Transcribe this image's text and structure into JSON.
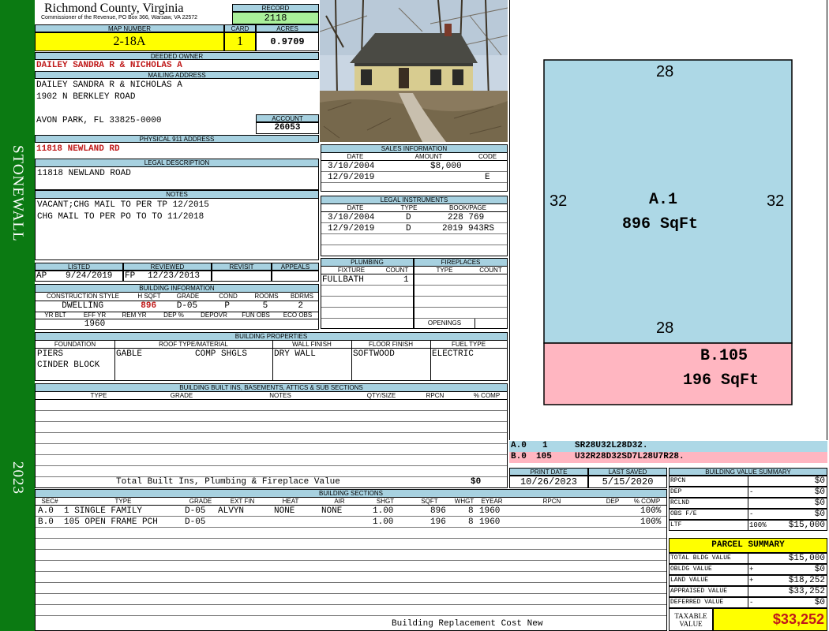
{
  "side": {
    "left_text": "STONEWALL",
    "year": "2023"
  },
  "header": {
    "county": "Richmond County, Virginia",
    "address_line": "Commissioner of the Revenue, PO Box 366, Warsaw, VA 22572",
    "record_label": "RECORD",
    "record": "2118",
    "map_number_label": "MAP NUMBER",
    "map_number": "2-18A",
    "card_label": "CARD",
    "card": "1",
    "acres_label": "ACRES",
    "acres": "0.9709"
  },
  "owner": {
    "label": "DEEDED OWNER",
    "value": "DAILEY SANDRA R & NICHOLAS A"
  },
  "mailing": {
    "label": "MAILING ADDRESS",
    "line1": "DAILEY SANDRA R & NICHOLAS A",
    "line2": "1902 N BERKLEY ROAD",
    "line3": "AVON PARK, FL 33825-0000",
    "account_label": "ACCOUNT",
    "account": "26053"
  },
  "physical": {
    "label": "PHYSICAL 911 ADDRESS",
    "value": "11818 NEWLAND RD"
  },
  "legal": {
    "label": "LEGAL DESCRIPTION",
    "value": "11818 NEWLAND ROAD"
  },
  "notes": {
    "label": "NOTES",
    "line1": "VACANT;CHG MAIL TO PER TP 12/2015",
    "line2": "CHG MAIL TO PER PO TO TO 11/2018"
  },
  "sales": {
    "label": "SALES INFORMATION",
    "cols": [
      "DATE",
      "AMOUNT",
      "CODE"
    ],
    "rows": [
      {
        "date": "3/10/2004",
        "amount": "$8,000",
        "code": ""
      },
      {
        "date": "12/9/2019",
        "amount": "",
        "code": "E"
      }
    ]
  },
  "instruments": {
    "label": "LEGAL INSTRUMENTS",
    "cols": [
      "DATE",
      "TYPE",
      "BOOK/PAGE"
    ],
    "rows": [
      {
        "date": "3/10/2004",
        "type": "D",
        "book": "228 769"
      },
      {
        "date": "12/9/2019",
        "type": "D",
        "book": "2019 943RS"
      }
    ]
  },
  "listed": {
    "labels": [
      "LISTED",
      "REVIEWED",
      "REVISIT",
      "APPEALS"
    ],
    "listed_by": "AP",
    "listed_date": "9/24/2019",
    "reviewed_by": "FP",
    "reviewed_date": "12/23/2013"
  },
  "building_info": {
    "label": "BUILDING INFORMATION",
    "cols1": [
      "CONSTRUCTION STYLE",
      "H SQFT",
      "GRADE",
      "COND",
      "ROOMS",
      "BDRMS"
    ],
    "vals1": [
      "DWELLING",
      "896",
      "D-05",
      "P",
      "5",
      "2"
    ],
    "cols2": [
      "YR BLT",
      "EFF YR",
      "REM YR",
      "DEP %",
      "DEPOVR",
      "FUN OBS",
      "ECO OBS"
    ],
    "vals2": [
      "",
      "1960",
      "",
      "",
      "",
      "",
      ""
    ]
  },
  "plumbing": {
    "label": "PLUMBING",
    "cols": [
      "FIXTURE",
      "COUNT"
    ],
    "fixture": "FULLBATH",
    "count": "1"
  },
  "fireplaces": {
    "label": "FIREPLACES",
    "cols": [
      "TYPE",
      "COUNT"
    ],
    "openings_label": "OPENINGS"
  },
  "properties": {
    "label": "BUILDING PROPERTIES",
    "cols": [
      "FOUNDATION",
      "ROOF TYPE/MATERIAL",
      "WALL FINISH",
      "FLOOR FINISH",
      "FUEL TYPE"
    ],
    "foundation1": "PIERS",
    "foundation2": "CINDER BLOCK",
    "roof_type": "GABLE",
    "roof_material": "COMP SHGLS",
    "wall": "DRY WALL",
    "floor": "SOFTWOOD",
    "fuel": "ELECTRIC"
  },
  "builtins": {
    "label": "BUILDING BUILT INS, BASEMENTS, ATTICS & SUB SECTIONS",
    "cols": [
      "TYPE",
      "GRADE",
      "NOTES",
      "QTY/SIZE",
      "RPCN",
      "% COMP"
    ],
    "total_label": "Total Built Ins, Plumbing & Fireplace Value",
    "total": "$0"
  },
  "sketch": {
    "a_top": "28",
    "a_left": "32",
    "a_right": "32",
    "a_bottom": "28",
    "a_label": "A.1",
    "a_area": "896 SqFt",
    "b_label": "B.105",
    "b_area": "196 SqFt",
    "colors": {
      "a": "#add8e6",
      "b": "#ffb6c1"
    }
  },
  "vectors": [
    {
      "sec": "A.0",
      "code": "1",
      "path": "SR28U32L28D32."
    },
    {
      "sec": "B.0",
      "code": "105",
      "path": "U32R28D32SD7L28U7R28."
    }
  ],
  "print": {
    "print_label": "PRINT DATE",
    "print_date": "10/26/2023",
    "saved_label": "LAST SAVED",
    "saved_date": "5/15/2020"
  },
  "sections": {
    "label": "BUILDING SECTIONS",
    "cols": [
      "SEC#",
      "TYPE",
      "GRADE",
      "EXT FIN",
      "HEAT",
      "AIR",
      "SHGT",
      "SQFT",
      "WHGT",
      "EYEAR",
      "RPCN",
      "DEP",
      "% COMP"
    ],
    "rows": [
      {
        "sec": "A.0",
        "type": "1 SINGLE FAMILY",
        "grade": "D-05",
        "ext": "ALVYN",
        "heat": "NONE",
        "air": "NONE",
        "shgt": "1.00",
        "sqft": "896",
        "whgt": "8",
        "eyear": "1960",
        "rpcn": "",
        "dep": "",
        "comp": "100%"
      },
      {
        "sec": "B.0",
        "type": "105 OPEN FRAME PCH",
        "grade": "D-05",
        "ext": "",
        "heat": "",
        "air": "",
        "shgt": "1.00",
        "sqft": "196",
        "whgt": "8",
        "eyear": "1960",
        "rpcn": "",
        "dep": "",
        "comp": "100%"
      }
    ],
    "footer": "Building Replacement Cost New"
  },
  "value_summary": {
    "label": "BUILDING VALUE SUMMARY",
    "rows": [
      {
        "label": "RPCN",
        "op": "",
        "value": "$0"
      },
      {
        "label": "DEP",
        "op": "-",
        "value": "$0"
      },
      {
        "label": "RCLND",
        "op": "",
        "value": "$0"
      },
      {
        "label": "OBS F/E",
        "op": "-",
        "value": "$0"
      },
      {
        "label": "LTF",
        "op": "100%",
        "value": "$15,000"
      }
    ]
  },
  "parcel": {
    "label": "PARCEL SUMMARY",
    "rows": [
      {
        "label": "TOTAL BLDG VALUE",
        "op": "",
        "value": "$15,000"
      },
      {
        "label": "OBLDG VALUE",
        "op": "+",
        "value": "$0"
      },
      {
        "label": "LAND VALUE",
        "op": "+",
        "value": "$18,252"
      },
      {
        "label": "APPRAISED VALUE",
        "op": "",
        "value": "$33,252"
      },
      {
        "label": "DEFERRED VALUE",
        "op": "-",
        "value": "$0"
      }
    ],
    "taxable_label1": "TAXABLE",
    "taxable_label2": "VALUE",
    "taxable": "$33,252"
  }
}
